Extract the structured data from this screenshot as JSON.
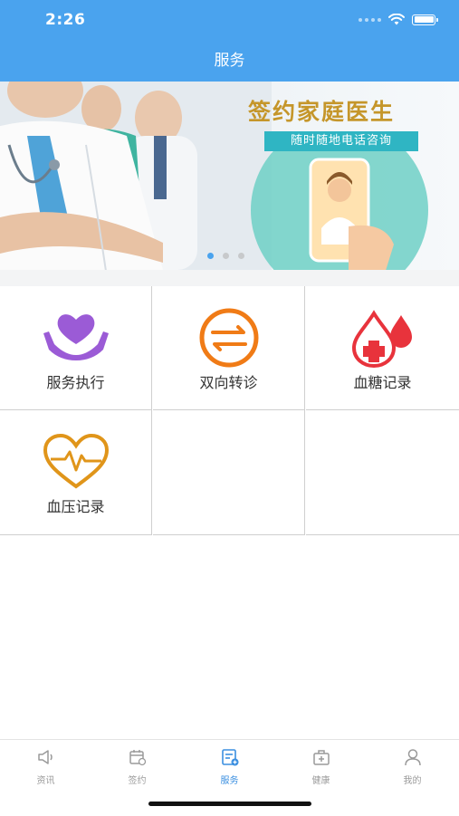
{
  "status": {
    "time": "2:26"
  },
  "header": {
    "title": "服务"
  },
  "banner": {
    "title": "签约家庭医生",
    "subtitle": "随时随地电话咨询",
    "pages": 3,
    "active_page": 1
  },
  "services": [
    {
      "label": "服务执行",
      "icon": "heart-hands-icon",
      "color": "#9b5bd6"
    },
    {
      "label": "双向转诊",
      "icon": "transfer-arrows-icon",
      "color": "#f07b16"
    },
    {
      "label": "血糖记录",
      "icon": "blood-drop-icon",
      "color": "#e8333c"
    },
    {
      "label": "血压记录",
      "icon": "heartbeat-icon",
      "color": "#e0951a"
    }
  ],
  "tabs": [
    {
      "label": "资讯",
      "icon": "news-icon"
    },
    {
      "label": "签约",
      "icon": "calendar-icon"
    },
    {
      "label": "服务",
      "icon": "service-icon",
      "active": true
    },
    {
      "label": "健康",
      "icon": "medical-kit-icon"
    },
    {
      "label": "我的",
      "icon": "user-icon"
    }
  ],
  "colors": {
    "primary": "#4aa3ee",
    "tab_active": "#3b8fe0",
    "tab_inactive": "#9a9a9a"
  }
}
